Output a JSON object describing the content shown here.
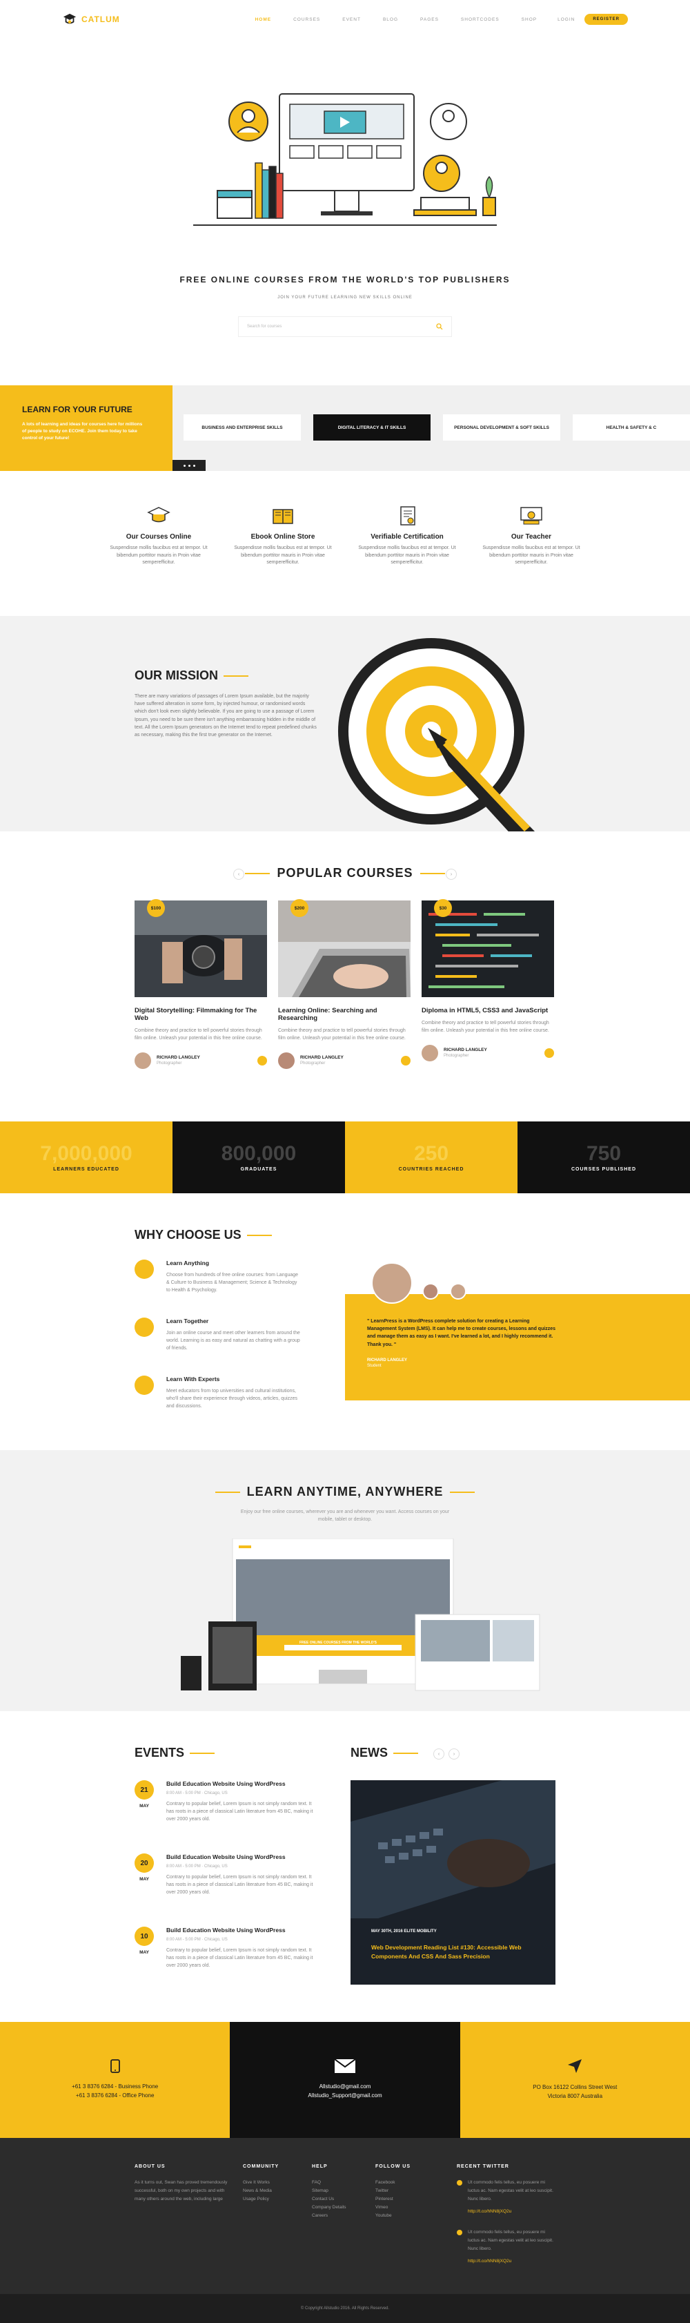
{
  "brand": {
    "name": "CATLUM",
    "accent": "#f5bd1b",
    "dark": "#111111"
  },
  "nav": {
    "items": [
      "HOME",
      "COURSES",
      "EVENT",
      "BLOG",
      "PAGES",
      "SHORTCODES",
      "SHOP"
    ],
    "active_index": 0,
    "login": "LOGIN",
    "register": "REGISTER"
  },
  "hero": {
    "title": "FREE ONLINE COURSES FROM THE WORLD'S TOP PUBLISHERS",
    "subtitle": "JOIN YOUR FUTURE LEARNING NEW SKILLS ONLINE",
    "search_placeholder": "Search for courses",
    "search_icon": "search-icon"
  },
  "categories": {
    "feature_title": "LEARN FOR YOUR FUTURE",
    "feature_text": "A lots of learning and ideas for courses here for millions of people to study on ECOHE. Join them today to take control of your future!",
    "tabs": [
      "BUSINESS AND ENTERPRISE SKILLS",
      "DIGITAL LITERACY & IT SKILLS",
      "PERSONAL DEVELOPMENT & SOFT SKILLS",
      "HEALTH & SAFETY & C"
    ],
    "active_tab": 1
  },
  "features": [
    {
      "title": "Our Courses Online",
      "text": "Suspendisse mollis faucibus est at tempor. Ut bibendum porttitor mauris in Proin vitae semperefficitur.",
      "icon": "graduation-cap-icon"
    },
    {
      "title": "Ebook Online Store",
      "text": "Suspendisse mollis faucibus est at tempor. Ut bibendum porttitor mauris in Proin vitae semperefficitur.",
      "icon": "ebook-icon"
    },
    {
      "title": "Verifiable Certification",
      "text": "Suspendisse mollis faucibus est at tempor. Ut bibendum porttitor mauris in Proin vitae semperefficitur.",
      "icon": "certificate-icon"
    },
    {
      "title": "Our Teacher",
      "text": "Suspendisse mollis faucibus est at tempor. Ut bibendum porttitor mauris in Proin vitae semperefficitur.",
      "icon": "teacher-icon"
    }
  ],
  "mission": {
    "title": "OUR MISSION",
    "text": "There are many variations of passages of Lorem Ipsum available, but the majority have suffered alteration in some form, by injected humour, or randomised words which don't look even slightly believable. If you are going to use a passage of Lorem Ipsum, you need to be sure there isn't anything embarrassing hidden in the middle of text. All the Lorem Ipsum generators on the Internet tend to repeat predefined chunks as necessary, making this the first true generator on the Internet."
  },
  "courses": {
    "title": "POPULAR COURSES",
    "items": [
      {
        "price": "$100",
        "title": "Digital Storytelling: Filmmaking for The Web",
        "text": "Combine theory and practice to tell powerful stories through film online. Unleash your potential in this free online course.",
        "author": "RICHARD LANGLEY",
        "role": "Photographer"
      },
      {
        "price": "$200",
        "title": "Learning Online: Searching and Researching",
        "text": "Combine theory and practice to tell powerful stories through film online. Unleash your potential in this free online course.",
        "author": "RICHARD LANGLEY",
        "role": "Photographer"
      },
      {
        "price": "$30",
        "title": "Diploma in HTML5, CSS3 and JavaScript",
        "text": "Combine theory and practice to tell powerful stories through film online. Unleash your potential in this free online course.",
        "author": "RICHARD LANGLEY",
        "role": "Photographer"
      }
    ]
  },
  "stats": [
    {
      "value": "7,000,000",
      "label": "LEARNERS EDUCATED"
    },
    {
      "value": "800,000",
      "label": "GRADUATES"
    },
    {
      "value": "250",
      "label": "COUNTRIES REACHED"
    },
    {
      "value": "750",
      "label": "COURSES PUBLISHED"
    }
  ],
  "why": {
    "title": "WHY CHOOSE US",
    "items": [
      {
        "title": "Learn Anything",
        "text": "Choose from hundreds of free online courses: from Language & Culture to Business & Management; Science & Technology to Health & Psychology."
      },
      {
        "title": "Learn Together",
        "text": "Join an online course and meet other learners from around the world. Learning is as easy and natural as chatting with a group of friends."
      },
      {
        "title": "Learn With Experts",
        "text": "Meet educators from top universities and cultural institutions, who'll share their experience through videos, articles, quizzes and discussions."
      }
    ],
    "testimonial": {
      "quote": "\" LearnPress is a WordPress complete solution for creating a Learning Management System (LMS). It can help me to create courses, lessons and quizzes and manage them as easy as I want. I've learned a lot, and I highly recommend it. Thank you. \"",
      "name": "RICHARD LANGLEY",
      "role": "Student"
    }
  },
  "anytime": {
    "title": "LEARN ANYTIME, ANYWHERE",
    "text": "Enjoy our free online courses, wherever you are and whenever you want. Access courses on your mobile, tablet or desktop.",
    "mock_title": "FREE ONLINE COURSES FROM THE WORLD'S TOP PUBLISHERS"
  },
  "events": {
    "title": "EVENTS",
    "items": [
      {
        "day": "21",
        "month": "MAY",
        "title": "Build Education Website Using WordPress",
        "meta": "8:00 AM - 5:00 PM  ·  Chicago, US",
        "text": "Contrary to popular belief, Lorem Ipsum is not simply random text. It has roots in a piece of classical Latin literature from 45 BC, making it over 2000 years old."
      },
      {
        "day": "20",
        "month": "MAY",
        "title": "Build Education Website Using WordPress",
        "meta": "8:00 AM - 5:00 PM  ·  Chicago, US",
        "text": "Contrary to popular belief, Lorem Ipsum is not simply random text. It has roots in a piece of classical Latin literature from 45 BC, making it over 2000 years old."
      },
      {
        "day": "10",
        "month": "MAY",
        "title": "Build Education Website Using WordPress",
        "meta": "8:00 AM - 5:00 PM  ·  Chicago, US",
        "text": "Contrary to popular belief, Lorem Ipsum is not simply random text. It has roots in a piece of classical Latin literature from 45 BC, making it over 2000 years old."
      }
    ]
  },
  "news": {
    "title": "NEWS",
    "meta": "MAY 30TH, 2016    ELITE MOBILITY",
    "headline": "Web Development Reading List #130: Accessible Web Components And CSS And Sass Precision"
  },
  "contact": [
    {
      "icon": "phone-icon",
      "line1": "+61 3 8376 6284 - Business Phone",
      "line2": "+61 3 8376 6284 - Office Phone"
    },
    {
      "icon": "envelope-icon",
      "line1": "Allstudio@gmail.com",
      "line2": "Allstudio_Support@gmail.com"
    },
    {
      "icon": "location-arrow-icon",
      "line1": "PO Box 16122 Collins Street West",
      "line2": "Victoria 8007 Australia"
    }
  ],
  "footer": {
    "about": {
      "title": "ABOUT US",
      "text": "As it turns out, Swan has proved tremendously successful, both on my own projects and with many others around the web, including large"
    },
    "community": {
      "title": "COMMUNITY",
      "links": [
        "Give It Works",
        "News & Media",
        "Usage Policy"
      ]
    },
    "help": {
      "title": "HELP",
      "links": [
        "FAQ",
        "Sitemap",
        "Contact Us",
        "Company Details",
        "Careers"
      ]
    },
    "follow": {
      "title": "FOLLOW US",
      "links": [
        "Facebook",
        "Twitter",
        "Pinterest",
        "Vimeo",
        "Youtube"
      ]
    },
    "twitter": {
      "title": "RECENT TWITTER",
      "tweets": [
        {
          "text": "Ut commodo felis tellus, eu posuere mi luctus ac. Nam egestas velit at leo suscipit. Nunc libero.",
          "link": "http://t.co/hNN8jXQ2u"
        },
        {
          "text": "Ut commodo felis tellus, eu posuere mi luctus ac. Nam egestas velit at leo suscipit. Nunc libero.",
          "link": "http://t.co/hNN8jXQ2u"
        }
      ]
    },
    "copyright": "© Copyright Allstudio 2016. All Rights Reserved."
  }
}
